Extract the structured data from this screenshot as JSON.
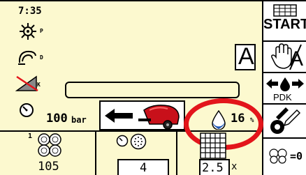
{
  "status": {
    "time": "7:35"
  },
  "modes": {
    "pto_suffix": "P",
    "pickup_suffix": "D",
    "knife_suffix": "K",
    "mode_letter": "A"
  },
  "message_field": {
    "text": ""
  },
  "pressure": {
    "value": "100",
    "unit": "bar"
  },
  "moisture": {
    "value": "16",
    "unit": "%"
  },
  "counters": {
    "bale_layer": "1",
    "bale_count": "105",
    "net_wraps": "4",
    "net_multiplier": "2.5",
    "net_multiplier_unit": "x",
    "total_suffix": "=0"
  },
  "right_panel": {
    "start_label": "START",
    "hand_mode_label": "A",
    "pdk_label": "PDK"
  },
  "colors": {
    "background": "#fcf9cf",
    "highlight_ring": "#e3151b",
    "moisture_drop": "#1c57b5",
    "baler_body": "#c8101a"
  },
  "icons": [
    "pto-shaft-icon",
    "pickup-icon",
    "knife-disabled-icon",
    "pressure-gauge-icon",
    "direction-arrow-left-icon",
    "baler-icon",
    "water-drop-icon",
    "bale-stack-icon",
    "net-roll-icon",
    "grid-icon",
    "hand-icon",
    "pdk-arrows-icon",
    "pen-icon",
    "bales-total-icon"
  ]
}
